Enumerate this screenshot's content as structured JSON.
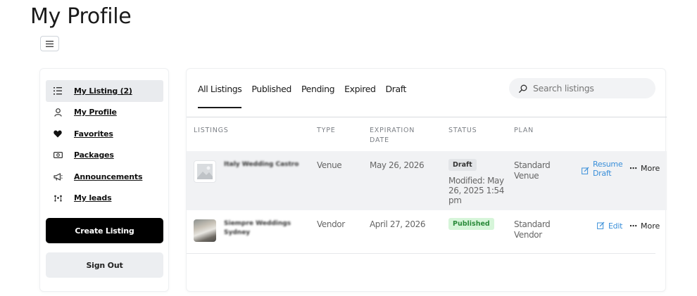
{
  "page": {
    "title": "My Profile"
  },
  "sidebar": {
    "items": [
      {
        "label": "My Listing (2)",
        "icon": "list-icon",
        "active": true
      },
      {
        "label": "My Profile",
        "icon": "user-icon"
      },
      {
        "label": "Favorites",
        "icon": "heart-icon"
      },
      {
        "label": "Packages",
        "icon": "money-icon"
      },
      {
        "label": "Announcements",
        "icon": "megaphone-icon"
      },
      {
        "label": "My leads",
        "icon": "network-icon"
      }
    ],
    "create_label": "Create Listing",
    "signout_label": "Sign Out"
  },
  "tabs": [
    {
      "label": "All Listings",
      "active": true
    },
    {
      "label": "Published"
    },
    {
      "label": "Pending"
    },
    {
      "label": "Expired"
    },
    {
      "label": "Draft"
    }
  ],
  "search": {
    "placeholder": "Search listings"
  },
  "table": {
    "headers": {
      "listings": "LISTINGS",
      "type": "TYPE",
      "expiration": "EXPIRATION DATE",
      "status": "STATUS",
      "plan": "PLAN"
    },
    "rows": [
      {
        "name": "Italy Wedding Castro",
        "type": "Venue",
        "expiration": "May 26, 2026",
        "status": "Draft",
        "modified": "Modified: May 26, 2025 1:54 pm",
        "plan": "Standard Venue",
        "action": "Resume Draft",
        "more": "More"
      },
      {
        "name": "Siempre Weddings Sydney",
        "type": "Vendor",
        "expiration": "April 27, 2026",
        "status": "Published",
        "plan": "Standard Vendor",
        "action": "Edit",
        "more": "More"
      }
    ]
  },
  "colors": {
    "accent": "#3a8fd9",
    "published_bg": "#d6f5d9",
    "published_text": "#2a8a3a",
    "draft_bg": "#e3e5e8"
  }
}
